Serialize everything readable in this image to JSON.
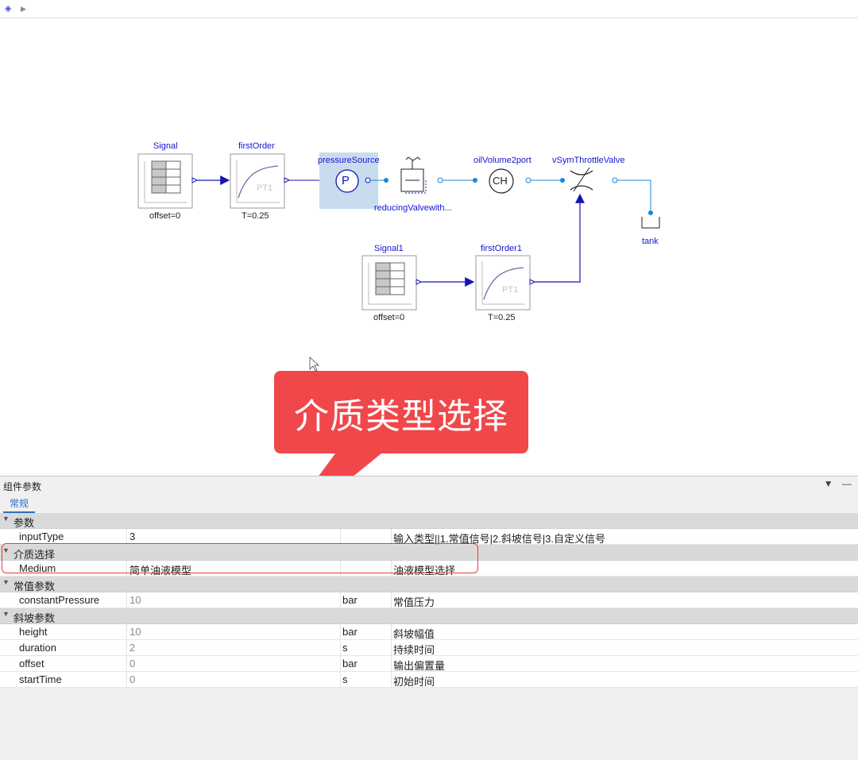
{
  "colors": {
    "accent": "#1414d4",
    "callout": "#f0474b",
    "highlight": "#e23a3a",
    "tab": "#2a6fc9"
  },
  "toolbar": {
    "model_icon": "layers-icon",
    "play_icon": "play-icon"
  },
  "diagram": {
    "signal": {
      "name": "Signal",
      "param": "offset=0"
    },
    "first_order": {
      "name": "firstOrder",
      "param": "T=0.25",
      "inner": "PT1"
    },
    "pressure_source": {
      "name": "pressureSource",
      "symbol": "P"
    },
    "reducing_valve": {
      "name": "reducingValvewith..."
    },
    "oil_volume": {
      "name": "oilVolume2port",
      "symbol": "CH"
    },
    "throttle_valve": {
      "name": "vSymThrottleValve"
    },
    "tank": {
      "name": "tank"
    },
    "signal1": {
      "name": "Signal1",
      "param": "offset=0"
    },
    "first_order1": {
      "name": "firstOrder1",
      "param": "T=0.25",
      "inner": "PT1"
    }
  },
  "callout": {
    "text": "介质类型选择"
  },
  "panel": {
    "title": "组件参数",
    "tab": "常规",
    "groups": [
      {
        "name": "参数",
        "rows": [
          {
            "name": "inputType",
            "value": "3",
            "unit": "",
            "desc": "输入类型||1.常值信号|2.斜坡信号|3.自定义信号"
          }
        ]
      },
      {
        "name": "介质选择",
        "rows": [
          {
            "name": "Medium",
            "value": "简单油液模型",
            "unit": "",
            "desc": "油液模型选择"
          }
        ]
      },
      {
        "name": "常值参数",
        "rows": [
          {
            "name": "constantPressure",
            "value": "10",
            "unit": "bar",
            "desc": "常值压力"
          }
        ]
      },
      {
        "name": "斜坡参数",
        "rows": [
          {
            "name": "height",
            "value": "10",
            "unit": "bar",
            "desc": "斜坡幅值"
          },
          {
            "name": "duration",
            "value": "2",
            "unit": "s",
            "desc": "持续时间"
          },
          {
            "name": "offset",
            "value": "0",
            "unit": "bar",
            "desc": "输出偏置量"
          },
          {
            "name": "startTime",
            "value": "0",
            "unit": "s",
            "desc": "初始时间"
          }
        ]
      }
    ]
  }
}
